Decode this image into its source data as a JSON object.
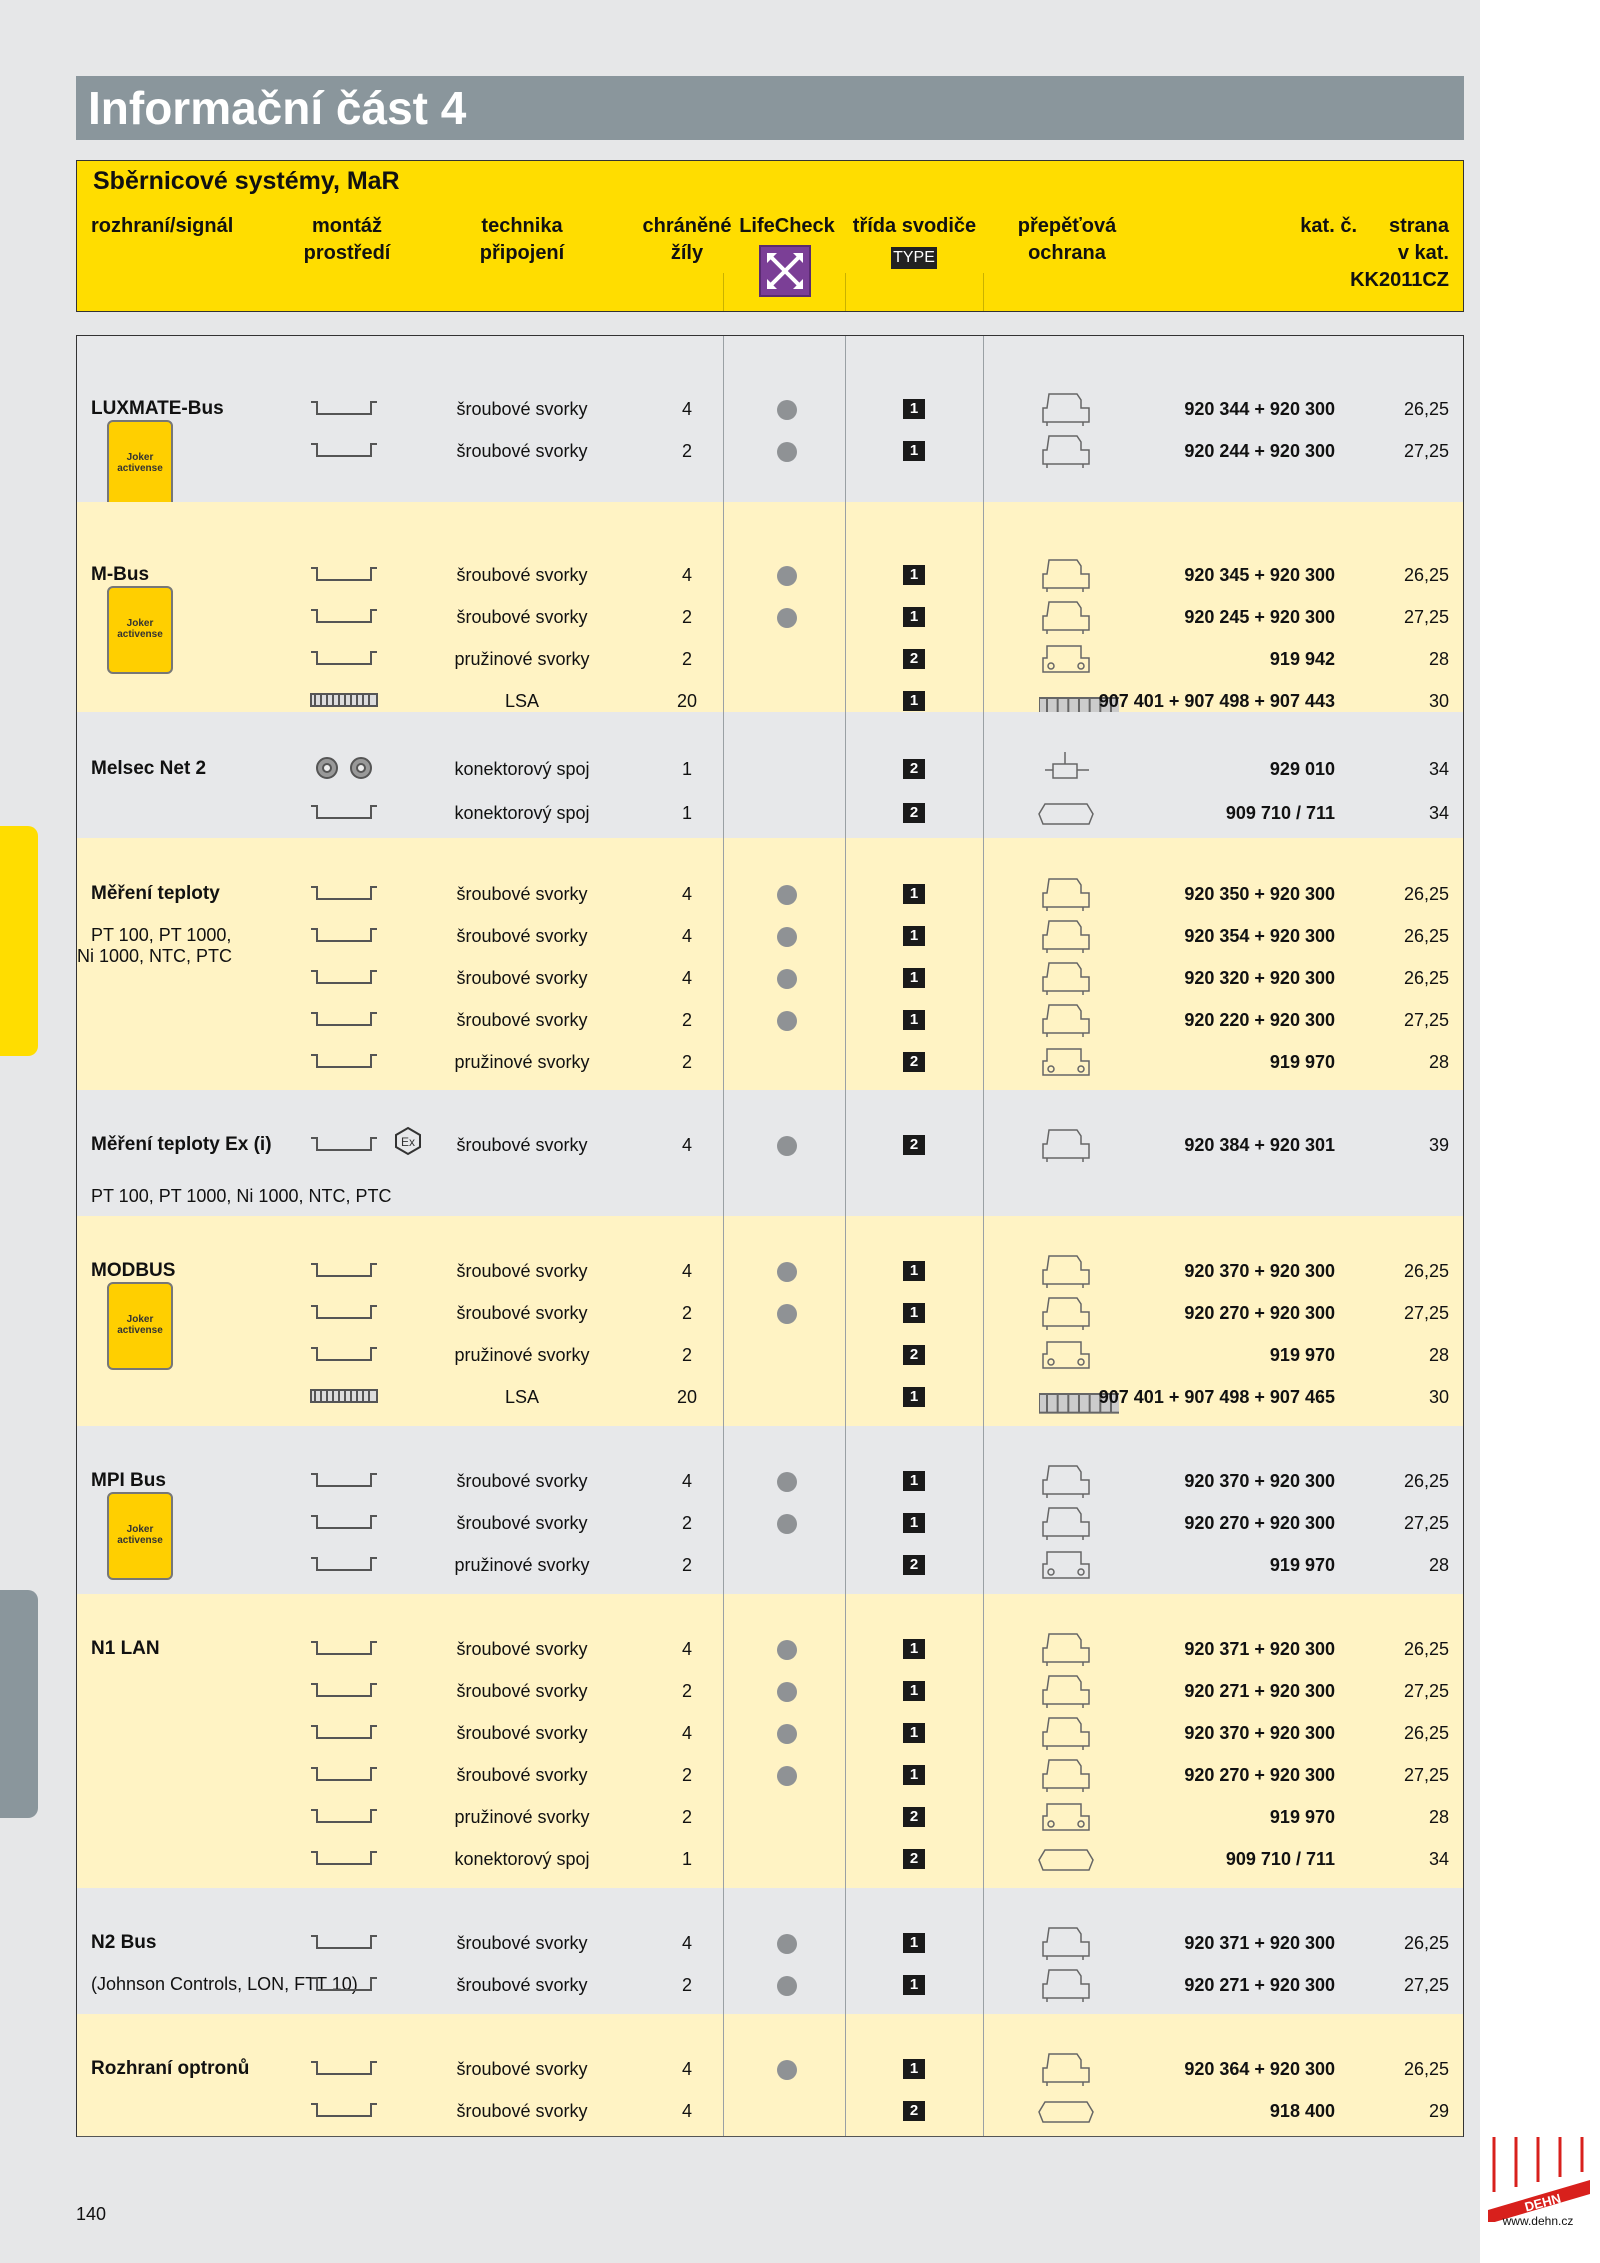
{
  "page": {
    "title": "Informační část 4",
    "page_number": "140",
    "website": "www.dehn.cz",
    "logo_text": "DEHN"
  },
  "header": {
    "section": "Sběrnicové systémy, MaR",
    "cols": {
      "signal": "rozhraní/signál",
      "mount1": "montáž",
      "mount2": "prostředí",
      "tech1": "technika",
      "tech2": "připojení",
      "wires1": "chráněné",
      "wires2": "žíly",
      "lifecheck": "LifeCheck",
      "class1": "třída svodiče",
      "class2": "TYPE",
      "prot1": "přepěťová",
      "prot2": "ochrana",
      "kat": "kat. č.",
      "str1": "strana",
      "str2": "v kat.",
      "str3": "KK2011CZ"
    }
  },
  "joker_label": "Joker activense",
  "groups": [
    {
      "name": "LUXMATE-Bus",
      "sub": "",
      "rows": [
        {
          "mount": "rail",
          "tech": "šroubové svorky",
          "wires": "4",
          "lc": true,
          "type": "1",
          "dev": "blue",
          "kat": "920 344 + 920 300",
          "str": "26,25"
        },
        {
          "mount": "rail",
          "tech": "šroubové svorky",
          "wires": "2",
          "lc": true,
          "type": "1",
          "dev": "blue",
          "kat": "920 244 + 920 300",
          "str": "27,25"
        }
      ]
    },
    {
      "name": "M-Bus",
      "sub": "",
      "rows": [
        {
          "mount": "rail",
          "tech": "šroubové svorky",
          "wires": "4",
          "lc": true,
          "type": "1",
          "dev": "blue",
          "kat": "920 345 + 920 300",
          "str": "26,25"
        },
        {
          "mount": "rail",
          "tech": "šroubové svorky",
          "wires": "2",
          "lc": true,
          "type": "1",
          "dev": "blue",
          "kat": "920 245 + 920 300",
          "str": "27,25"
        },
        {
          "mount": "rail",
          "tech": "pružinové svorky",
          "wires": "2",
          "lc": false,
          "type": "2",
          "dev": "spring",
          "kat": "919 942",
          "str": "28"
        },
        {
          "mount": "lsa",
          "tech": "LSA",
          "wires": "20",
          "lc": false,
          "type": "1",
          "dev": "lsa",
          "kat": "907 401 + 907 498 + 907 443",
          "str": "30"
        }
      ]
    },
    {
      "name": "Melsec Net 2",
      "sub": "",
      "rows": [
        {
          "mount": "conn",
          "tech": "konektorový spoj",
          "wires": "1",
          "lc": false,
          "type": "2",
          "dev": "coax",
          "kat": "929 010",
          "str": "34"
        },
        {
          "mount": "rail",
          "tech": "konektorový spoj",
          "wires": "1",
          "lc": false,
          "type": "2",
          "dev": "flat",
          "kat": "909 710 / 711",
          "str": "34"
        }
      ]
    },
    {
      "name": "Měření teploty",
      "sub": "PT 100, PT 1000,\nNi 1000, NTC, PTC",
      "rows": [
        {
          "mount": "rail",
          "tech": "šroubové svorky",
          "wires": "4",
          "lc": true,
          "type": "1",
          "dev": "blue",
          "kat": "920 350 + 920 300",
          "str": "26,25"
        },
        {
          "mount": "rail",
          "tech": "šroubové svorky",
          "wires": "4",
          "lc": true,
          "type": "1",
          "dev": "blue",
          "kat": "920 354 + 920 300",
          "str": "26,25"
        },
        {
          "mount": "rail",
          "tech": "šroubové svorky",
          "wires": "4",
          "lc": true,
          "type": "1",
          "dev": "blue",
          "kat": "920 320 + 920 300",
          "str": "26,25"
        },
        {
          "mount": "rail",
          "tech": "šroubové svorky",
          "wires": "2",
          "lc": true,
          "type": "1",
          "dev": "blue",
          "kat": "920 220 + 920 300",
          "str": "27,25"
        },
        {
          "mount": "rail",
          "tech": "pružinové svorky",
          "wires": "2",
          "lc": false,
          "type": "2",
          "dev": "spring",
          "kat": "919 970",
          "str": "28"
        }
      ]
    },
    {
      "name": "Měření teploty Ex (i)",
      "sub": "PT 100, PT 1000, Ni 1000, NTC, PTC",
      "rows": [
        {
          "mount": "ex",
          "tech": "šroubové svorky",
          "wires": "4",
          "lc": true,
          "type": "2",
          "dev": "blue",
          "kat": "920 384 + 920 301",
          "str": "39"
        }
      ]
    },
    {
      "name": "MODBUS",
      "sub": "",
      "rows": [
        {
          "mount": "rail",
          "tech": "šroubové svorky",
          "wires": "4",
          "lc": true,
          "type": "1",
          "dev": "blue",
          "kat": "920 370 + 920 300",
          "str": "26,25"
        },
        {
          "mount": "rail",
          "tech": "šroubové svorky",
          "wires": "2",
          "lc": true,
          "type": "1",
          "dev": "blue",
          "kat": "920 270 + 920 300",
          "str": "27,25"
        },
        {
          "mount": "rail",
          "tech": "pružinové svorky",
          "wires": "2",
          "lc": false,
          "type": "2",
          "dev": "spring",
          "kat": "919 970",
          "str": "28"
        },
        {
          "mount": "lsa",
          "tech": "LSA",
          "wires": "20",
          "lc": false,
          "type": "1",
          "dev": "lsa",
          "kat": "907 401 + 907 498 + 907 465",
          "str": "30"
        }
      ]
    },
    {
      "name": "MPI Bus",
      "sub": "",
      "rows": [
        {
          "mount": "rail",
          "tech": "šroubové svorky",
          "wires": "4",
          "lc": true,
          "type": "1",
          "dev": "blue",
          "kat": "920 370 + 920 300",
          "str": "26,25"
        },
        {
          "mount": "rail",
          "tech": "šroubové svorky",
          "wires": "2",
          "lc": true,
          "type": "1",
          "dev": "blue",
          "kat": "920 270 + 920 300",
          "str": "27,25"
        },
        {
          "mount": "rail",
          "tech": "pružinové svorky",
          "wires": "2",
          "lc": false,
          "type": "2",
          "dev": "spring",
          "kat": "919 970",
          "str": "28"
        }
      ]
    },
    {
      "name": "N1 LAN",
      "sub": "",
      "rows": [
        {
          "mount": "rail",
          "tech": "šroubové svorky",
          "wires": "4",
          "lc": true,
          "type": "1",
          "dev": "blue",
          "kat": "920 371 + 920 300",
          "str": "26,25"
        },
        {
          "mount": "rail",
          "tech": "šroubové svorky",
          "wires": "2",
          "lc": true,
          "type": "1",
          "dev": "blue",
          "kat": "920 271 + 920 300",
          "str": "27,25"
        },
        {
          "mount": "rail",
          "tech": "šroubové svorky",
          "wires": "4",
          "lc": true,
          "type": "1",
          "dev": "blue",
          "kat": "920 370 + 920 300",
          "str": "26,25"
        },
        {
          "mount": "rail",
          "tech": "šroubové svorky",
          "wires": "2",
          "lc": true,
          "type": "1",
          "dev": "blue",
          "kat": "920 270 + 920 300",
          "str": "27,25"
        },
        {
          "mount": "rail",
          "tech": "pružinové svorky",
          "wires": "2",
          "lc": false,
          "type": "2",
          "dev": "spring",
          "kat": "919 970",
          "str": "28"
        },
        {
          "mount": "rail",
          "tech": "konektorový spoj",
          "wires": "1",
          "lc": false,
          "type": "2",
          "dev": "flat",
          "kat": "909 710 / 711",
          "str": "34"
        }
      ]
    },
    {
      "name": "N2 Bus",
      "sub": "(Johnson Controls, LON, FTT 10)",
      "rows": [
        {
          "mount": "rail",
          "tech": "šroubové svorky",
          "wires": "4",
          "lc": true,
          "type": "1",
          "dev": "blue",
          "kat": "920 371 + 920 300",
          "str": "26,25"
        },
        {
          "mount": "rail",
          "tech": "šroubové svorky",
          "wires": "2",
          "lc": true,
          "type": "1",
          "dev": "blue",
          "kat": "920 271 + 920 300",
          "str": "27,25"
        }
      ]
    },
    {
      "name": "Rozhraní optronů",
      "sub": "",
      "rows": [
        {
          "mount": "rail",
          "tech": "šroubové svorky",
          "wires": "4",
          "lc": true,
          "type": "1",
          "dev": "blue",
          "kat": "920 364 + 920 300",
          "str": "26,25"
        },
        {
          "mount": "rail",
          "tech": "šroubové svorky",
          "wires": "4",
          "lc": false,
          "type": "2",
          "dev": "flat",
          "kat": "918 400",
          "str": "29"
        }
      ]
    }
  ]
}
